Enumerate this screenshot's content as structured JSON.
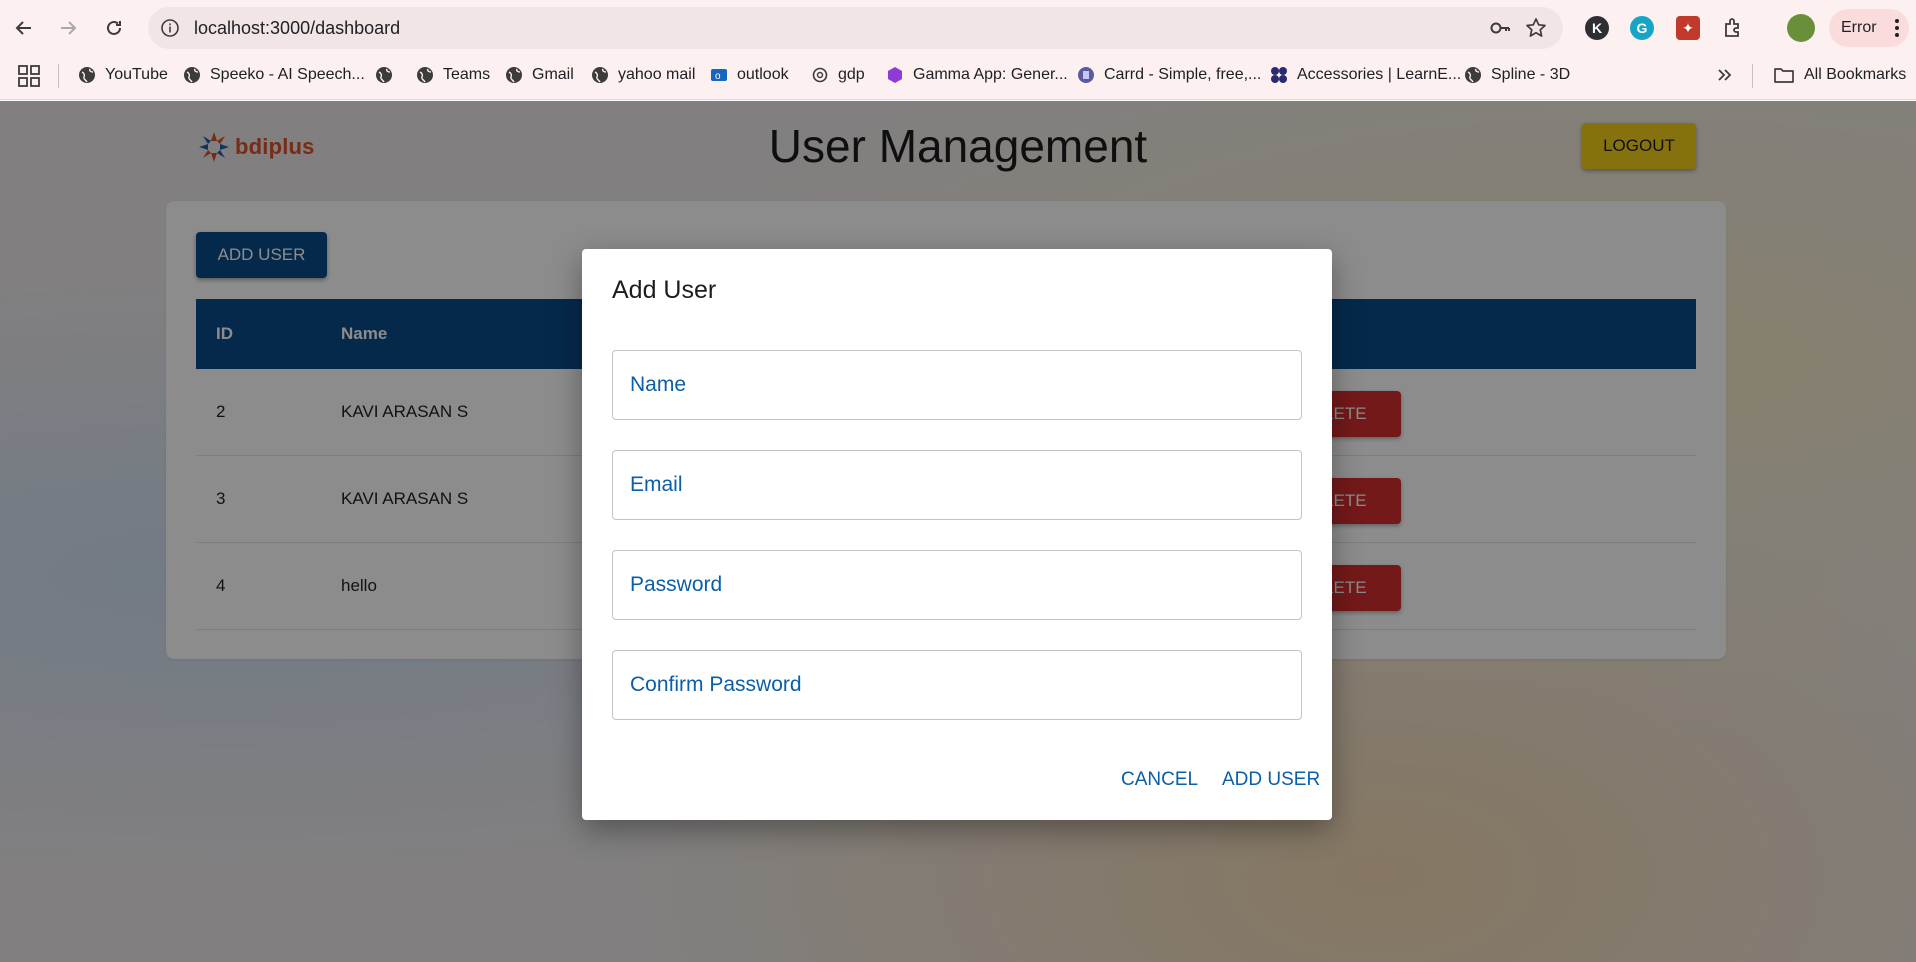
{
  "browser": {
    "url": "localhost:3000/dashboard",
    "profile_status": "Error",
    "bookmarks": [
      {
        "label": "YouTube"
      },
      {
        "label": "Speeko - AI Speech..."
      },
      {
        "label": ""
      },
      {
        "label": "Teams"
      },
      {
        "label": "Gmail"
      },
      {
        "label": "yahoo mail"
      },
      {
        "label": "outlook"
      },
      {
        "label": "gdp"
      },
      {
        "label": "Gamma App: Gener..."
      },
      {
        "label": "Carrd - Simple, free,..."
      },
      {
        "label": "Accessories | LearnE..."
      },
      {
        "label": "Spline - 3D"
      }
    ],
    "all_bookmarks": "All Bookmarks"
  },
  "header": {
    "logo_text": "bdiplus",
    "title": "User Management",
    "logout_label": "LOGOUT"
  },
  "main": {
    "add_user_label": "ADD USER",
    "columns": [
      "ID",
      "Name"
    ],
    "rows": [
      {
        "id": "2",
        "name": "KAVI ARASAN S",
        "action": "DELETE"
      },
      {
        "id": "3",
        "name": "KAVI ARASAN S",
        "action": "DELETE"
      },
      {
        "id": "4",
        "name": "hello",
        "action": "DELETE"
      }
    ]
  },
  "dialog": {
    "title": "Add User",
    "fields": {
      "name_placeholder": "Name",
      "email_placeholder": "Email",
      "password_placeholder": "Password",
      "confirm_placeholder": "Confirm Password"
    },
    "cancel_label": "CANCEL",
    "submit_label": "ADD USER"
  },
  "colors": {
    "primary": "#0a4c89",
    "logout": "#f3d01a",
    "delete": "#d32f2f",
    "link": "#0a5fa8"
  }
}
